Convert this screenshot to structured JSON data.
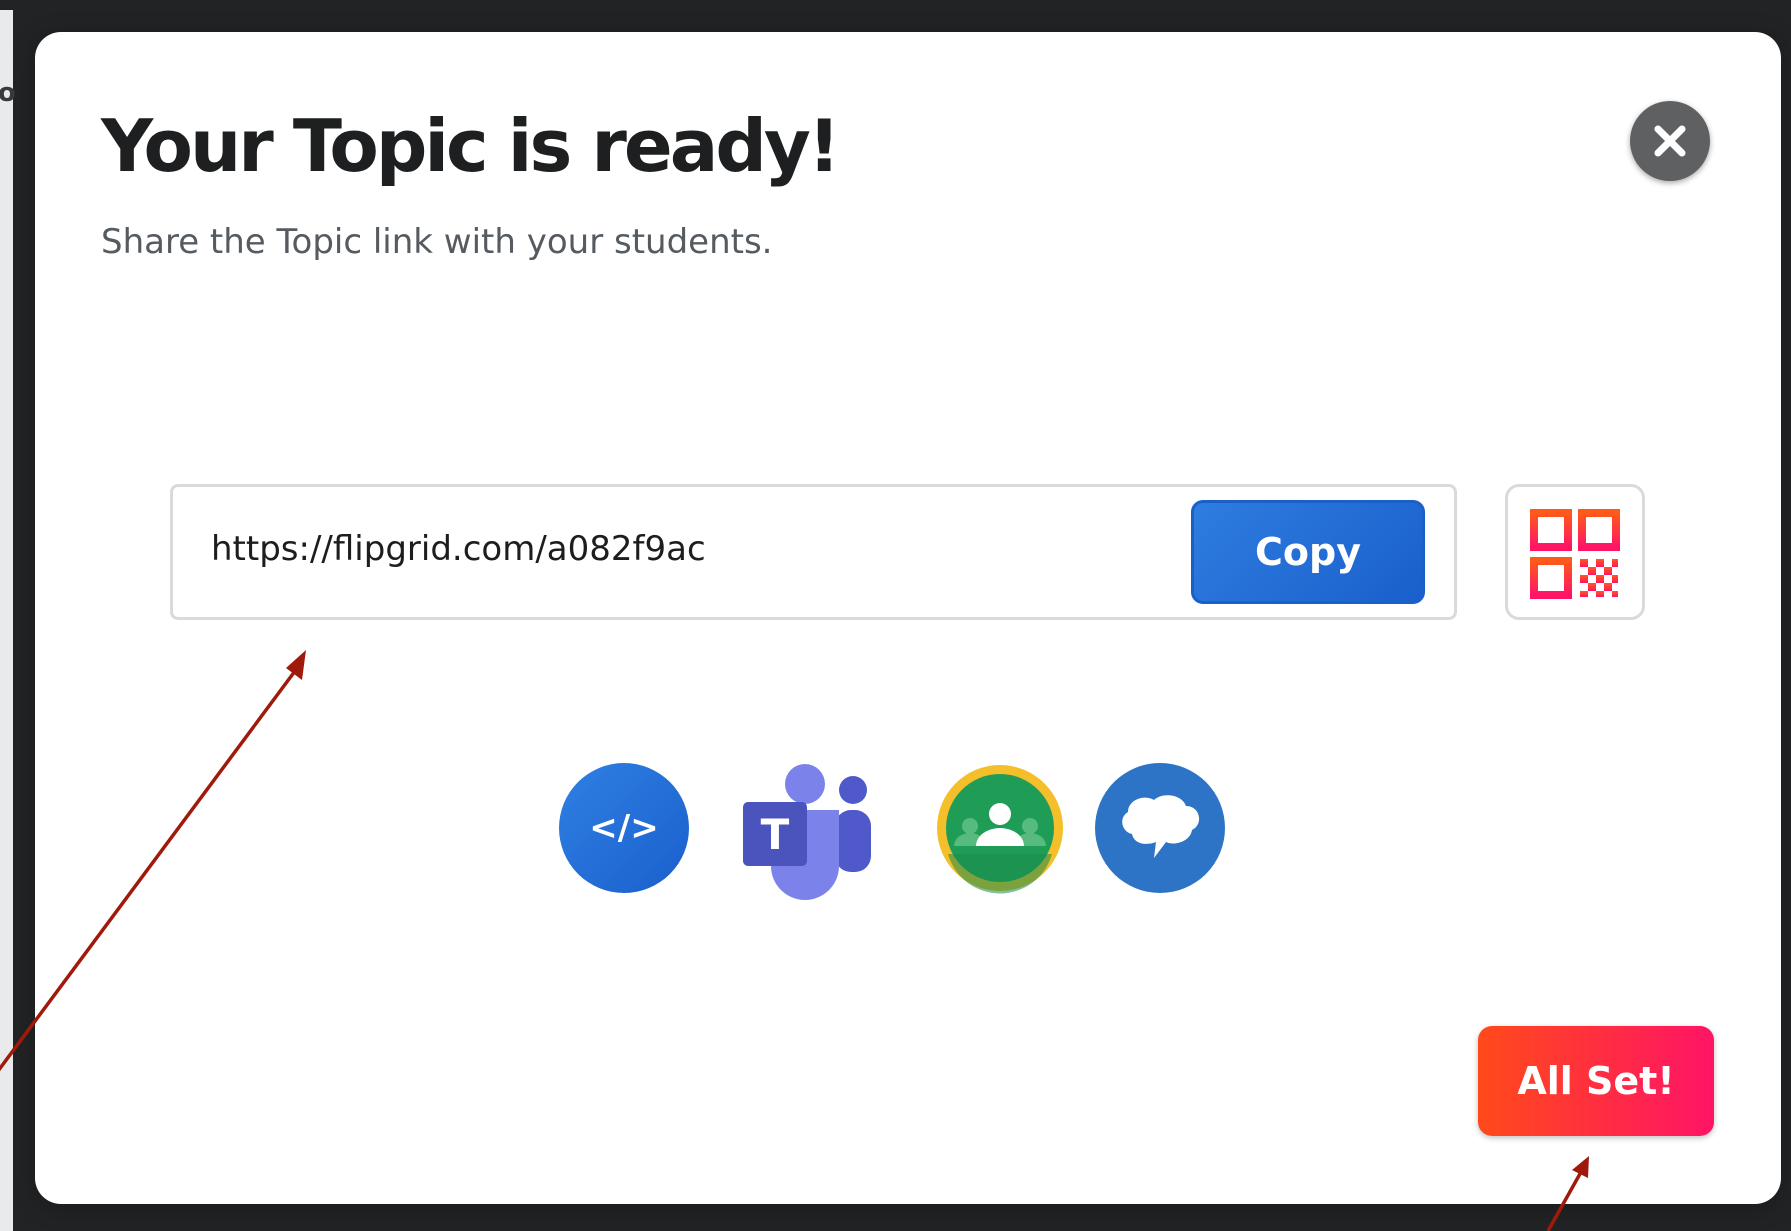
{
  "background": {
    "page_fragment": "o"
  },
  "modal": {
    "title": "Your Topic is ready!",
    "subtitle": "Share the Topic link with your students.",
    "close_icon": "close-icon"
  },
  "share_link": {
    "url": "https://flipgrid.com/a082f9ac",
    "copy_label": "Copy",
    "qr_icon": "qr-code-icon"
  },
  "share_options": [
    {
      "name": "embed-code",
      "icon": "code-icon",
      "label": "</>"
    },
    {
      "name": "microsoft-teams",
      "icon": "teams-icon",
      "label": "T"
    },
    {
      "name": "google-classroom",
      "icon": "classroom-icon"
    },
    {
      "name": "remind",
      "icon": "remind-icon"
    }
  ],
  "footer": {
    "all_set_label": "All Set!"
  },
  "colors": {
    "primary_blue": "#1f6fd8",
    "all_set_gradient_start": "#ff4a1a",
    "all_set_gradient_end": "#ff1466",
    "annotation_arrow": "#a01a0c",
    "backdrop": "#222324"
  }
}
